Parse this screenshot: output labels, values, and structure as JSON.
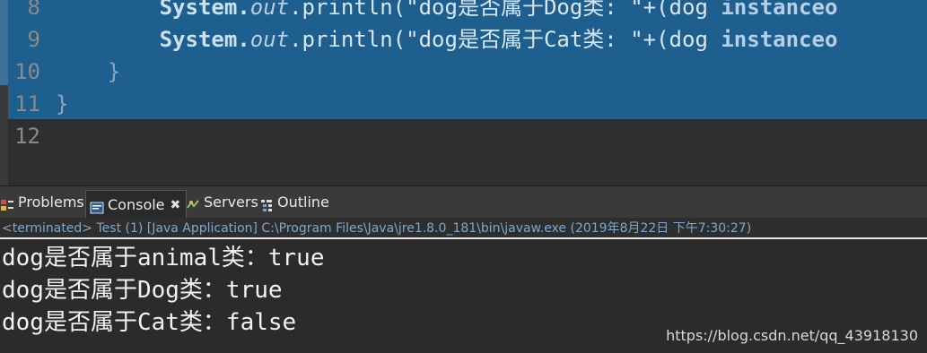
{
  "editor": {
    "line_numbers": [
      "8",
      "9",
      "10",
      "11",
      "12"
    ],
    "lines": [
      {
        "indent": "        ",
        "kw": "System.",
        "it": "out",
        "rest_a": ".println(\"dog是否属于Dog类: \"+(dog ",
        "cls": "instanceo"
      },
      {
        "indent": "        ",
        "kw": "System.",
        "it": "out",
        "rest_a": ".println(\"dog是否属于Cat类: \"+(dog ",
        "cls": "instanceo"
      },
      {
        "text": "    }"
      },
      {
        "text": "}"
      },
      {
        "text": ""
      }
    ]
  },
  "tabs": {
    "problems": "Problems",
    "console": "Console",
    "console_close": "✖",
    "servers": "Servers",
    "outline": "Outline"
  },
  "status": "<terminated> Test (1) [Java Application] C:\\Program Files\\Java\\jre1.8.0_181\\bin\\javaw.exe (2019年8月22日 下午7:30:27)",
  "output": [
    "dog是否属于animal类：true",
    "dog是否属于Dog类：true",
    "dog是否属于Cat类：false"
  ],
  "watermark": "https://blog.csdn.net/qq_43918130",
  "colors": {
    "selection": "#1f5f8f",
    "status_text": "#7fa7ce",
    "console_bg": "#2b2b2b"
  }
}
